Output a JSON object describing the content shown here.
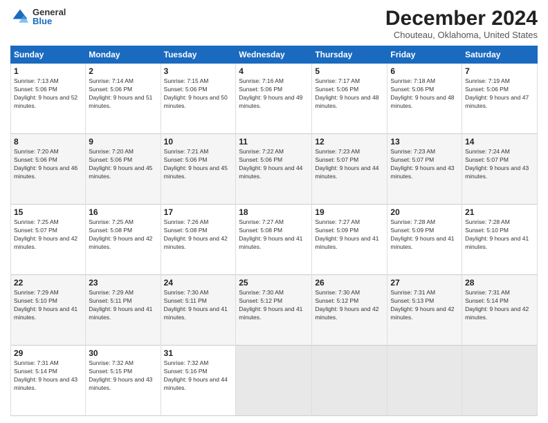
{
  "header": {
    "logo_general": "General",
    "logo_blue": "Blue",
    "month_title": "December 2024",
    "location": "Chouteau, Oklahoma, United States"
  },
  "days_of_week": [
    "Sunday",
    "Monday",
    "Tuesday",
    "Wednesday",
    "Thursday",
    "Friday",
    "Saturday"
  ],
  "weeks": [
    [
      {
        "day": "1",
        "sunrise": "7:13 AM",
        "sunset": "5:06 PM",
        "daylight": "9 hours and 52 minutes."
      },
      {
        "day": "2",
        "sunrise": "7:14 AM",
        "sunset": "5:06 PM",
        "daylight": "9 hours and 51 minutes."
      },
      {
        "day": "3",
        "sunrise": "7:15 AM",
        "sunset": "5:06 PM",
        "daylight": "9 hours and 50 minutes."
      },
      {
        "day": "4",
        "sunrise": "7:16 AM",
        "sunset": "5:06 PM",
        "daylight": "9 hours and 49 minutes."
      },
      {
        "day": "5",
        "sunrise": "7:17 AM",
        "sunset": "5:06 PM",
        "daylight": "9 hours and 48 minutes."
      },
      {
        "day": "6",
        "sunrise": "7:18 AM",
        "sunset": "5:06 PM",
        "daylight": "9 hours and 48 minutes."
      },
      {
        "day": "7",
        "sunrise": "7:19 AM",
        "sunset": "5:06 PM",
        "daylight": "9 hours and 47 minutes."
      }
    ],
    [
      {
        "day": "8",
        "sunrise": "7:20 AM",
        "sunset": "5:06 PM",
        "daylight": "9 hours and 46 minutes."
      },
      {
        "day": "9",
        "sunrise": "7:20 AM",
        "sunset": "5:06 PM",
        "daylight": "9 hours and 45 minutes."
      },
      {
        "day": "10",
        "sunrise": "7:21 AM",
        "sunset": "5:06 PM",
        "daylight": "9 hours and 45 minutes."
      },
      {
        "day": "11",
        "sunrise": "7:22 AM",
        "sunset": "5:06 PM",
        "daylight": "9 hours and 44 minutes."
      },
      {
        "day": "12",
        "sunrise": "7:23 AM",
        "sunset": "5:07 PM",
        "daylight": "9 hours and 44 minutes."
      },
      {
        "day": "13",
        "sunrise": "7:23 AM",
        "sunset": "5:07 PM",
        "daylight": "9 hours and 43 minutes."
      },
      {
        "day": "14",
        "sunrise": "7:24 AM",
        "sunset": "5:07 PM",
        "daylight": "9 hours and 43 minutes."
      }
    ],
    [
      {
        "day": "15",
        "sunrise": "7:25 AM",
        "sunset": "5:07 PM",
        "daylight": "9 hours and 42 minutes."
      },
      {
        "day": "16",
        "sunrise": "7:25 AM",
        "sunset": "5:08 PM",
        "daylight": "9 hours and 42 minutes."
      },
      {
        "day": "17",
        "sunrise": "7:26 AM",
        "sunset": "5:08 PM",
        "daylight": "9 hours and 42 minutes."
      },
      {
        "day": "18",
        "sunrise": "7:27 AM",
        "sunset": "5:08 PM",
        "daylight": "9 hours and 41 minutes."
      },
      {
        "day": "19",
        "sunrise": "7:27 AM",
        "sunset": "5:09 PM",
        "daylight": "9 hours and 41 minutes."
      },
      {
        "day": "20",
        "sunrise": "7:28 AM",
        "sunset": "5:09 PM",
        "daylight": "9 hours and 41 minutes."
      },
      {
        "day": "21",
        "sunrise": "7:28 AM",
        "sunset": "5:10 PM",
        "daylight": "9 hours and 41 minutes."
      }
    ],
    [
      {
        "day": "22",
        "sunrise": "7:29 AM",
        "sunset": "5:10 PM",
        "daylight": "9 hours and 41 minutes."
      },
      {
        "day": "23",
        "sunrise": "7:29 AM",
        "sunset": "5:11 PM",
        "daylight": "9 hours and 41 minutes."
      },
      {
        "day": "24",
        "sunrise": "7:30 AM",
        "sunset": "5:11 PM",
        "daylight": "9 hours and 41 minutes."
      },
      {
        "day": "25",
        "sunrise": "7:30 AM",
        "sunset": "5:12 PM",
        "daylight": "9 hours and 41 minutes."
      },
      {
        "day": "26",
        "sunrise": "7:30 AM",
        "sunset": "5:12 PM",
        "daylight": "9 hours and 42 minutes."
      },
      {
        "day": "27",
        "sunrise": "7:31 AM",
        "sunset": "5:13 PM",
        "daylight": "9 hours and 42 minutes."
      },
      {
        "day": "28",
        "sunrise": "7:31 AM",
        "sunset": "5:14 PM",
        "daylight": "9 hours and 42 minutes."
      }
    ],
    [
      {
        "day": "29",
        "sunrise": "7:31 AM",
        "sunset": "5:14 PM",
        "daylight": "9 hours and 43 minutes."
      },
      {
        "day": "30",
        "sunrise": "7:32 AM",
        "sunset": "5:15 PM",
        "daylight": "9 hours and 43 minutes."
      },
      {
        "day": "31",
        "sunrise": "7:32 AM",
        "sunset": "5:16 PM",
        "daylight": "9 hours and 44 minutes."
      },
      null,
      null,
      null,
      null
    ]
  ]
}
